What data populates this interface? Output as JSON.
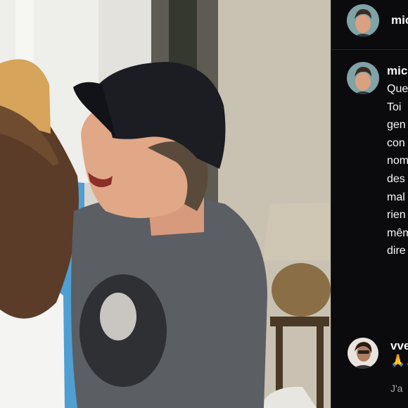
{
  "photo": {
    "description_icon": "photo-of-two-people"
  },
  "header": {
    "username": "mic",
    "avatar_icon": "user-avatar-icon"
  },
  "caption": {
    "username": "mic",
    "lines": [
      "Que",
      "Toi",
      "gen",
      "con",
      "nom",
      "des",
      "mal",
      "rien",
      "mêm",
      "dire"
    ]
  },
  "comment": {
    "username": "vve",
    "emoji": "🙏🙏",
    "meta": "J'a"
  },
  "colors": {
    "panel_bg": "#0b0b0d",
    "text": "#f5f5f5",
    "muted": "#a8a8a8",
    "divider": "#262626"
  }
}
